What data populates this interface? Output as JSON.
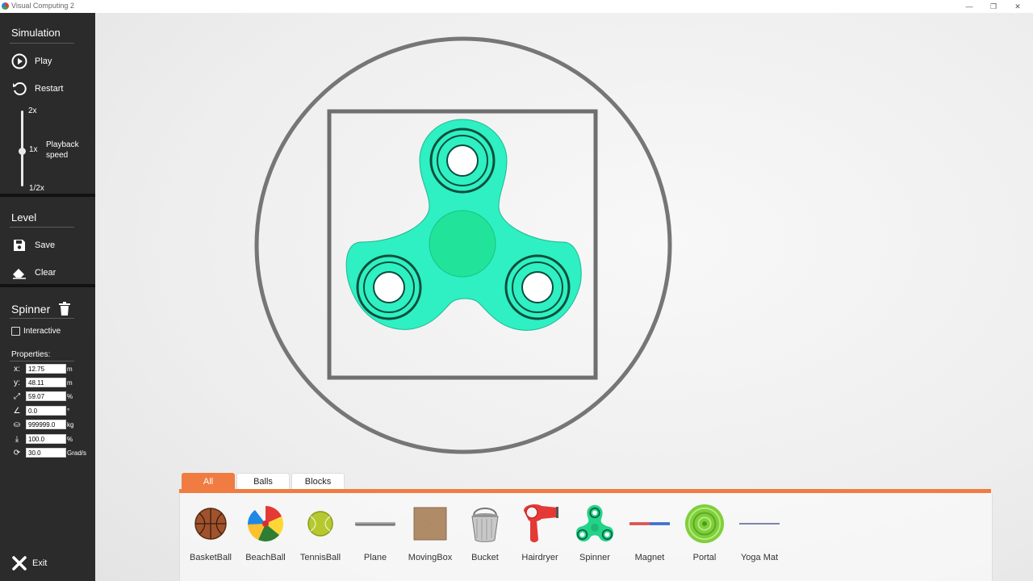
{
  "window": {
    "title": "Visual Computing 2",
    "controls": [
      "—",
      "❐",
      "✕"
    ]
  },
  "sidebar": {
    "simulation": {
      "heading": "Simulation",
      "play_label": "Play",
      "restart_label": "Restart"
    },
    "playback": {
      "label": "Playback speed",
      "max": "2x",
      "mid": "1x",
      "min": "1/2x",
      "value": "1x"
    },
    "level": {
      "heading": "Level",
      "save_label": "Save",
      "clear_label": "Clear"
    },
    "object": {
      "name": "Spinner",
      "interactive_label": "Interactive",
      "interactive_checked": false,
      "properties_label": "Properties:",
      "props": [
        {
          "icon": "x-icon",
          "glyph": "x:",
          "value": "12.75",
          "unit": "m"
        },
        {
          "icon": "y-icon",
          "glyph": "y:",
          "value": "48.11",
          "unit": "m"
        },
        {
          "icon": "scale-icon",
          "glyph": "⤢",
          "value": "59.07",
          "unit": "%"
        },
        {
          "icon": "angle-icon",
          "glyph": "∠",
          "value": "0.0",
          "unit": "°"
        },
        {
          "icon": "weight-icon",
          "glyph": "⛀",
          "value": "999999.0",
          "unit": "kg"
        },
        {
          "icon": "gravity-icon",
          "glyph": "⤓",
          "value": "100.0",
          "unit": "%"
        },
        {
          "icon": "rotation-icon",
          "glyph": "⟳",
          "value": "30.0",
          "unit": "Grad/s"
        }
      ]
    },
    "exit_label": "Exit"
  },
  "colors": {
    "accent": "#f07c42",
    "sidebar_bg": "#2b2b2b",
    "spinner": "#2ef0c2",
    "frame": "#777777"
  },
  "palette": {
    "tabs": [
      {
        "label": "All",
        "active": true
      },
      {
        "label": "Balls",
        "active": false
      },
      {
        "label": "Blocks",
        "active": false
      }
    ],
    "items": [
      {
        "name": "BasketBall",
        "icon": "basketball-icon"
      },
      {
        "name": "BeachBall",
        "icon": "beachball-icon"
      },
      {
        "name": "TennisBall",
        "icon": "tennisball-icon"
      },
      {
        "name": "Plane",
        "icon": "plane-icon"
      },
      {
        "name": "MovingBox",
        "icon": "box-icon"
      },
      {
        "name": "Bucket",
        "icon": "bucket-icon"
      },
      {
        "name": "Hairdryer",
        "icon": "hairdryer-icon"
      },
      {
        "name": "Spinner",
        "icon": "spinner-icon"
      },
      {
        "name": "Magnet",
        "icon": "magnet-icon"
      },
      {
        "name": "Portal",
        "icon": "portal-icon"
      },
      {
        "name": "Yoga Mat",
        "icon": "yogamat-icon"
      }
    ]
  }
}
